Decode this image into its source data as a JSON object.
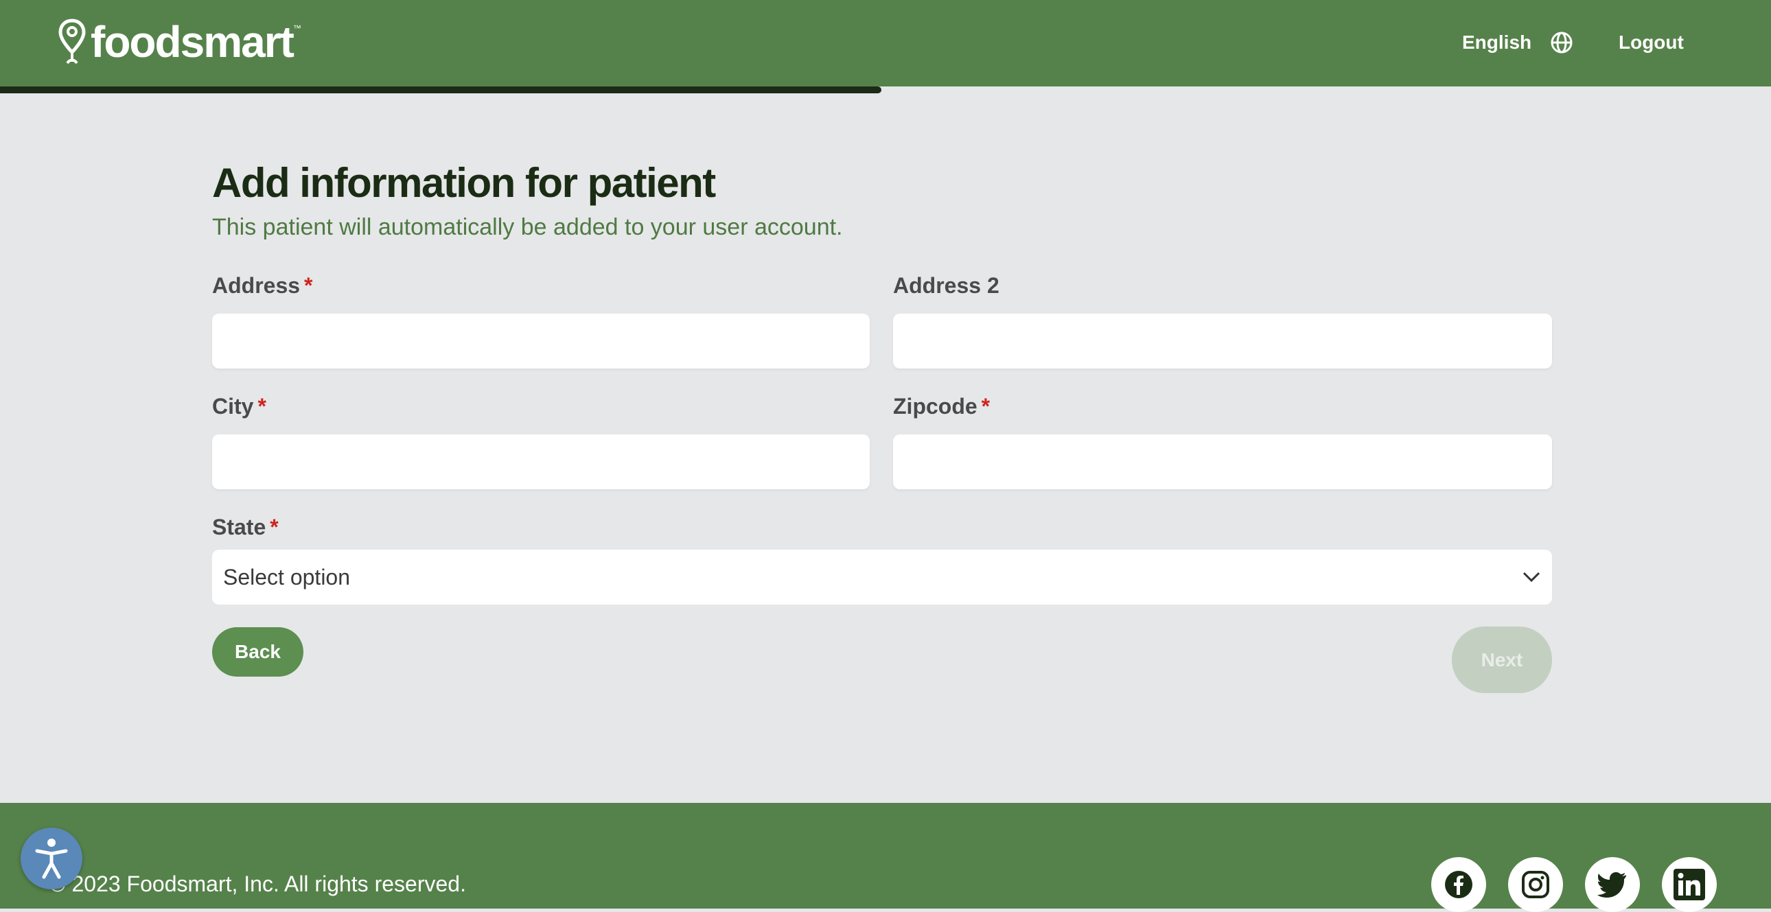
{
  "header": {
    "brand": "foodsmart",
    "brand_tm": "™",
    "language_label": "English",
    "logout_label": "Logout",
    "progress": 0.5
  },
  "main": {
    "title": "Add information for patient",
    "subtitle": "This patient will automatically be added to your user account.",
    "fields": {
      "address": {
        "label": "Address",
        "required": "*",
        "value": ""
      },
      "address2": {
        "label": "Address 2",
        "value": ""
      },
      "city": {
        "label": "City",
        "required": "*",
        "value": ""
      },
      "zipcode": {
        "label": "Zipcode",
        "required": "*",
        "value": ""
      },
      "state": {
        "label": "State",
        "required": "*",
        "selected": "Select option"
      }
    },
    "back_label": "Back",
    "next_label": "Next"
  },
  "footer": {
    "copyright": "© 2023 Foodsmart, Inc. All rights reserved.",
    "social": [
      "facebook-icon",
      "instagram-icon",
      "twitter-icon",
      "linkedin-icon"
    ]
  },
  "colors": {
    "brand_green": "#55824a",
    "title_dark": "#1b2c14",
    "subtitle_green": "#4f7a43",
    "required_red": "#d0241f",
    "page_bg": "#e6e7e9"
  }
}
